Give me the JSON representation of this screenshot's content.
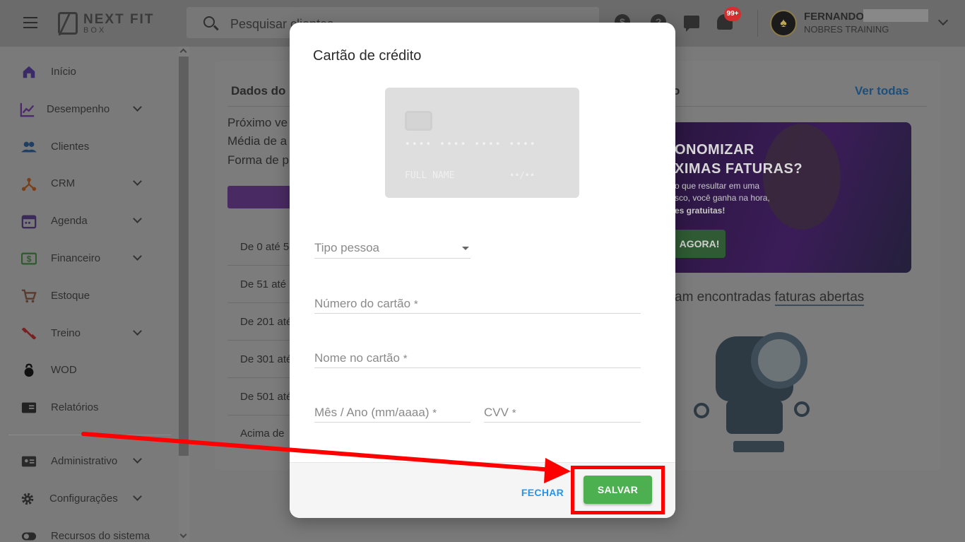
{
  "topbar": {
    "logo_main": "NEXT FIT",
    "logo_sub": "BOX",
    "search_placeholder": "Pesquisar clientes",
    "notification_badge": "99+",
    "user_name": "FERNANDO",
    "user_org": "NOBRES TRAINING",
    "icons": [
      "menu-icon",
      "search-icon",
      "money-icon",
      "help-icon",
      "chat-icon",
      "bell-icon",
      "chevron-down-icon"
    ]
  },
  "sidebar": {
    "items": [
      {
        "label": "Início",
        "icon": "home-icon",
        "color": "#3a2a6a"
      },
      {
        "label": "Desempenho",
        "icon": "chart-icon",
        "color": "#4a2a6a"
      },
      {
        "label": "Clientes",
        "icon": "people-icon",
        "color": "#1e3f63"
      },
      {
        "label": "CRM",
        "icon": "crm-icon",
        "color": "#7a3f17"
      },
      {
        "label": "Agenda",
        "icon": "calendar-icon",
        "color": "#3a2a5a"
      },
      {
        "label": "Financeiro",
        "icon": "money-icon",
        "color": "#2e5a2e"
      },
      {
        "label": "Estoque",
        "icon": "cart-icon",
        "color": "#5a3a2a"
      },
      {
        "label": "Treino",
        "icon": "dumbbell-icon",
        "color": "#7a1f1f"
      },
      {
        "label": "WOD",
        "icon": "kettlebell-icon",
        "color": "#111111"
      },
      {
        "label": "Relatórios",
        "icon": "report-icon",
        "color": "#222222"
      },
      {
        "label": "Administrativo",
        "icon": "id-card-icon",
        "color": "#2a2a2a"
      },
      {
        "label": "Configurações",
        "icon": "gear-icon",
        "color": "#2a2a2a"
      },
      {
        "label": "Recursos do sistema",
        "icon": "toggle-icon",
        "color": "#2a2a2a"
      }
    ]
  },
  "background": {
    "section_title_left": "Dados do p",
    "section_title_right": "o",
    "see_all": "Ver todas",
    "info_lines": [
      "Próximo ve",
      "Média de a",
      "Forma de p"
    ],
    "ranges": [
      "De 0 até 5",
      "De 51 até",
      "De 201 até",
      "De 301 até",
      "De 501 até",
      "Acima de"
    ],
    "promo_line1": "ONOMIZAR",
    "promo_line2": "XIMAS FATURAS?",
    "promo_small1": "o que resultar em uma",
    "promo_small2": "sco, você ganha na hora,",
    "promo_small3": "es gratuitas!",
    "promo_button": "AGORA!",
    "no_invoice_prefix": "am encontradas ",
    "no_invoice_link": "faturas abertas"
  },
  "modal": {
    "title": "Cartão de crédito",
    "card_preview": {
      "number": "•••• •••• •••• ••••",
      "name": "FULL NAME",
      "expiry": "••/••"
    },
    "fields": {
      "tipo_pessoa": "Tipo pessoa",
      "numero_cartao": "Número do cartão",
      "nome_cartao": "Nome no cartão",
      "mes_ano": "Mês / Ano (mm/aaaa)",
      "cvv": "CVV",
      "required_mark": "*"
    },
    "buttons": {
      "close": "FECHAR",
      "save": "SALVAR"
    }
  },
  "colors": {
    "save_button": "#4caf50",
    "close_link": "#2196f3",
    "annotation": "#ff0000",
    "badge": "#d32f2f"
  }
}
